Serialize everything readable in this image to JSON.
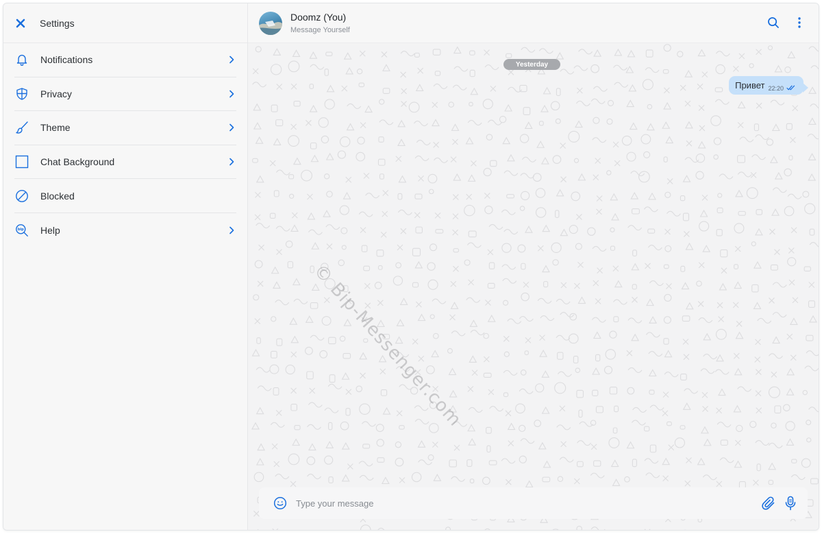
{
  "colors": {
    "accent": "#1a6fde",
    "bubble": "#c5e0fa",
    "date_pill": "#a7a9ad"
  },
  "sidebar": {
    "title": "Settings",
    "close_icon": "close-icon",
    "items": [
      {
        "label": "Notifications",
        "icon": "bell-icon",
        "has_chevron": true
      },
      {
        "label": "Privacy",
        "icon": "shield-icon",
        "has_chevron": true
      },
      {
        "label": "Theme",
        "icon": "brush-icon",
        "has_chevron": true
      },
      {
        "label": "Chat Background",
        "icon": "square-icon",
        "has_chevron": true
      },
      {
        "label": "Blocked",
        "icon": "blocked-icon",
        "has_chevron": false
      },
      {
        "label": "Help",
        "icon": "help-search-icon",
        "has_chevron": true
      }
    ]
  },
  "chat": {
    "contact_name": "Doomz (You)",
    "contact_status": "Message Yourself",
    "header_icons": [
      "search-icon",
      "more-vertical-icon"
    ],
    "date_separator": "Yesterday",
    "messages": [
      {
        "text": "Привет",
        "time": "22:20",
        "status": "read",
        "outgoing": true
      }
    ],
    "watermark": "© Bip-Messenger.com",
    "composer": {
      "placeholder": "Type your message",
      "value": "",
      "icons": [
        "emoji-icon",
        "attach-icon",
        "mic-icon"
      ]
    }
  }
}
